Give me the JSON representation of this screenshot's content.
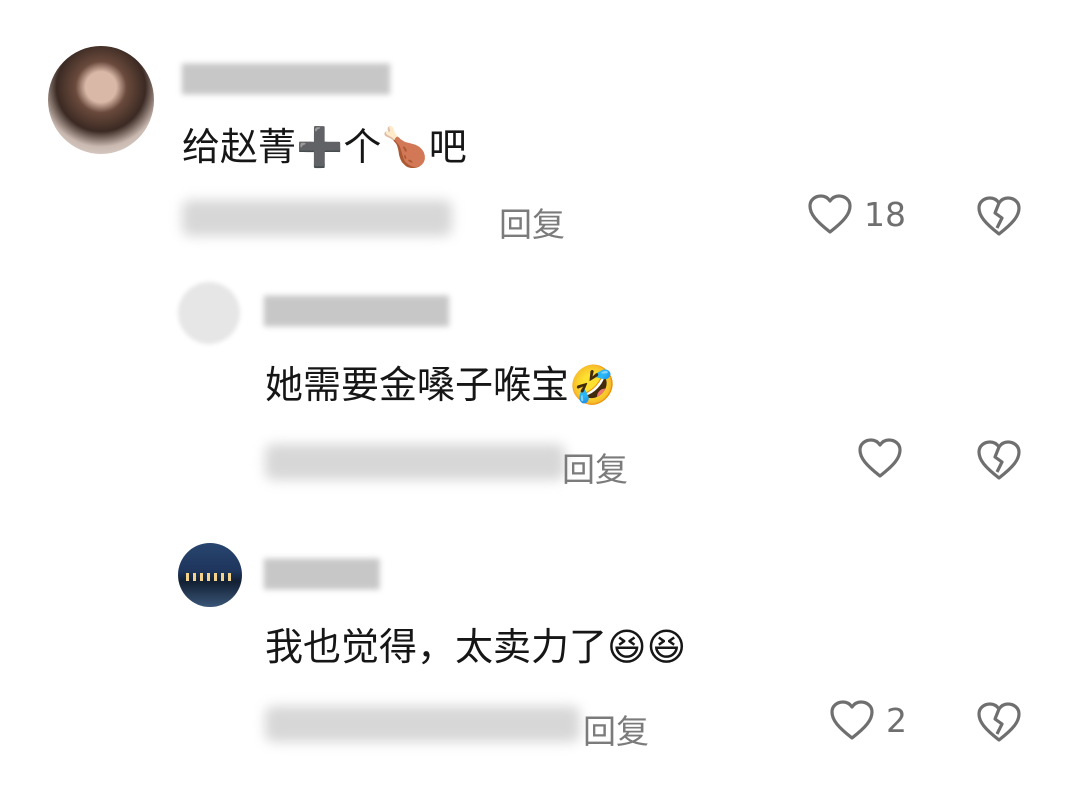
{
  "comments": [
    {
      "text": "给赵菁",
      "tail_text": "个",
      "tail_text2": "吧",
      "emoji_plus": "➕",
      "emoji_leg": "🍗",
      "reply_label": "回复",
      "like_count": "18"
    },
    {
      "text": "她需要金嗓子喉宝",
      "emoji": "🤣",
      "reply_label": "回复",
      "like_count": ""
    },
    {
      "text": "我也觉得，太卖力了",
      "emoji1": "😆",
      "emoji2": "😆",
      "reply_label": "回复",
      "like_count": "2"
    }
  ],
  "icons": {
    "like": "heart-outline-icon",
    "dislike": "broken-heart-icon"
  },
  "colors": {
    "text": "#161616",
    "muted": "#7b7b7b",
    "icon": "#6f6f6f"
  }
}
